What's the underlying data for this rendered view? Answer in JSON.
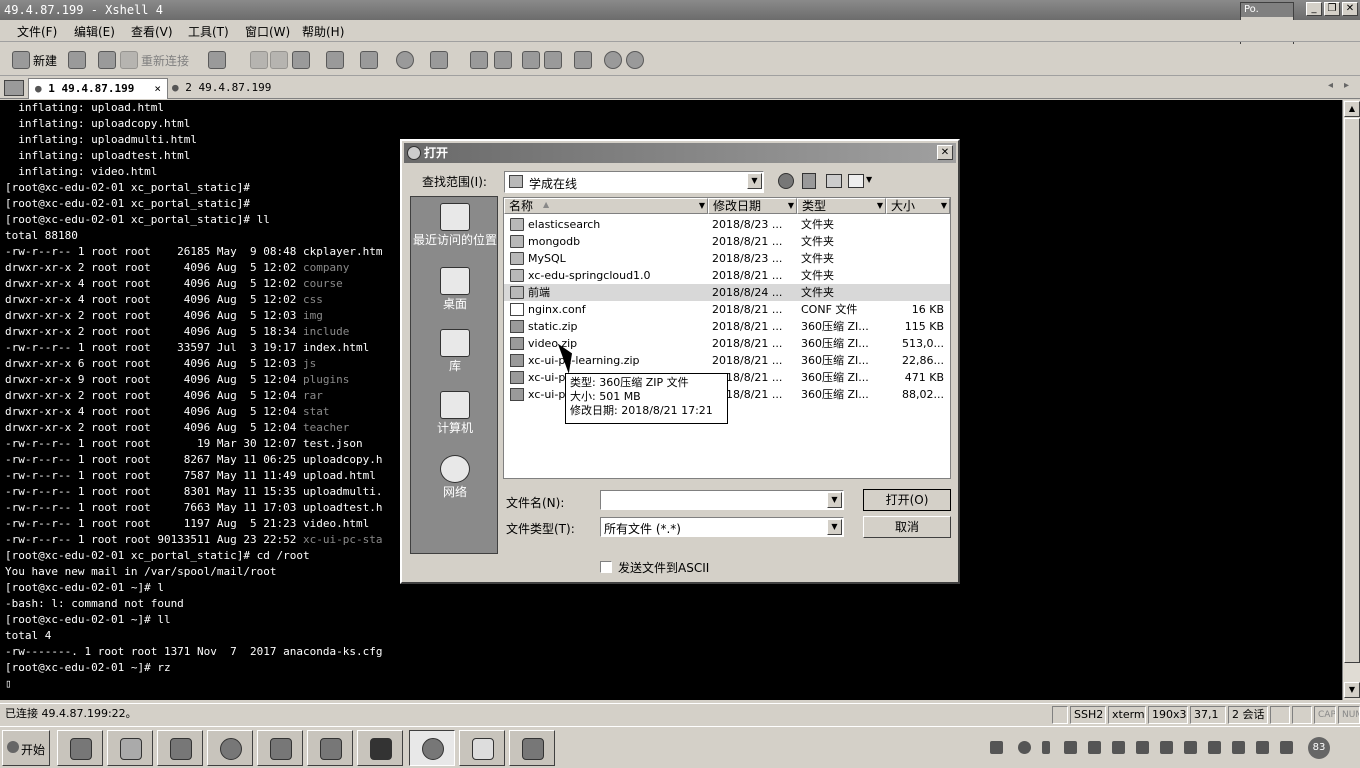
{
  "window": {
    "title": "49.4.87.199 - Xshell 4",
    "popup_title": "Po.",
    "popup_button": "开始"
  },
  "menu": [
    "文件(F)",
    "编辑(E)",
    "查看(V)",
    "工具(T)",
    "窗口(W)",
    "帮助(H)"
  ],
  "toolbar": {
    "new_label": "新建",
    "reconnect_label": "重新连接"
  },
  "tabs": [
    {
      "label": "1 49.4.87.199",
      "active": true
    },
    {
      "label": "2 49.4.87.199",
      "active": false
    }
  ],
  "terminal": {
    "lines": [
      "  inflating: upload.html",
      "  inflating: uploadcopy.html",
      "  inflating: uploadmulti.html",
      "  inflating: uploadtest.html",
      "  inflating: video.html",
      "[root@xc-edu-02-01 xc_portal_static]#",
      "[root@xc-edu-02-01 xc_portal_static]#",
      "[root@xc-edu-02-01 xc_portal_static]# ll",
      "total 88180",
      "-rw-r--r-- 1 root root    26185 May  9 08:48 ckplayer.htm",
      "drwxr-xr-x 2 root root     4096 Aug  5 12:02 company",
      "drwxr-xr-x 4 root root     4096 Aug  5 12:02 course",
      "drwxr-xr-x 4 root root     4096 Aug  5 12:02 css",
      "drwxr-xr-x 2 root root     4096 Aug  5 12:03 img",
      "drwxr-xr-x 2 root root     4096 Aug  5 18:34 include",
      "-rw-r--r-- 1 root root    33597 Jul  3 19:17 index.html",
      "drwxr-xr-x 6 root root     4096 Aug  5 12:03 js",
      "drwxr-xr-x 9 root root     4096 Aug  5 12:04 plugins",
      "drwxr-xr-x 2 root root     4096 Aug  5 12:04 rar",
      "drwxr-xr-x 4 root root     4096 Aug  5 12:04 stat",
      "drwxr-xr-x 2 root root     4096 Aug  5 12:04 teacher",
      "-rw-r--r-- 1 root root       19 Mar 30 12:07 test.json",
      "-rw-r--r-- 1 root root     8267 May 11 06:25 uploadcopy.h",
      "-rw-r--r-- 1 root root     7587 May 11 11:49 upload.html",
      "-rw-r--r-- 1 root root     8301 May 11 15:35 uploadmulti.",
      "-rw-r--r-- 1 root root     7663 May 11 17:03 uploadtest.h",
      "-rw-r--r-- 1 root root     1197 Aug  5 21:23 video.html",
      "-rw-r--r-- 1 root root 90133511 Aug 23 22:52 xc-ui-pc-sta",
      "[root@xc-edu-02-01 xc_portal_static]# cd /root",
      "You have new mail in /var/spool/mail/root",
      "[root@xc-edu-02-01 ~]# l",
      "-bash: l: command not found",
      "[root@xc-edu-02-01 ~]# ll",
      "total 4",
      "-rw-------. 1 root root 1371 Nov  7  2017 anaconda-ks.cfg",
      "[root@xc-edu-02-01 ~]# rz",
      "▯"
    ],
    "dim_lines": [
      10,
      11,
      12,
      13,
      14,
      16,
      17,
      18,
      19,
      20,
      27
    ]
  },
  "dialog": {
    "title": "打开",
    "lookin_label": "查找范围(I):",
    "lookin_value": "学成在线",
    "columns": [
      "名称",
      "修改日期",
      "类型",
      "大小"
    ],
    "files": [
      {
        "name": "elasticsearch",
        "date": "2018/8/23 ...",
        "type": "文件夹",
        "size": "",
        "kind": "folder"
      },
      {
        "name": "mongodb",
        "date": "2018/8/21 ...",
        "type": "文件夹",
        "size": "",
        "kind": "folder"
      },
      {
        "name": "MySQL",
        "date": "2018/8/23 ...",
        "type": "文件夹",
        "size": "",
        "kind": "folder"
      },
      {
        "name": "xc-edu-springcloud1.0",
        "date": "2018/8/21 ...",
        "type": "文件夹",
        "size": "",
        "kind": "folder"
      },
      {
        "name": "前端",
        "date": "2018/8/24 ...",
        "type": "文件夹",
        "size": "",
        "kind": "folder"
      },
      {
        "name": "nginx.conf",
        "date": "2018/8/21 ...",
        "type": "CONF 文件",
        "size": "16 KB",
        "kind": "file"
      },
      {
        "name": "static.zip",
        "date": "2018/8/21 ...",
        "type": "360压缩 ZI...",
        "size": "115 KB",
        "kind": "zip"
      },
      {
        "name": "video.zip",
        "date": "2018/8/21 ...",
        "type": "360压缩 ZI...",
        "size": "513,0...",
        "kind": "zip"
      },
      {
        "name": "xc-ui-pc-learning.zip",
        "date": "2018/8/21 ...",
        "type": "360压缩 ZI...",
        "size": "22,86...",
        "kind": "zip"
      },
      {
        "name": "xc-ui-pc-...",
        "date": "2018/8/21 ...",
        "type": "360压缩 ZI...",
        "size": "471 KB",
        "kind": "zip"
      },
      {
        "name": "xc-ui-pc-...",
        "date": "2018/8/21 ...",
        "type": "360压缩 ZI...",
        "size": "88,02...",
        "kind": "zip"
      }
    ],
    "selected_index": 4,
    "places": [
      "最近访问的位置",
      "桌面",
      "库",
      "计算机",
      "网络"
    ],
    "tooltip": {
      "type": "类型: 360压缩 ZIP 文件",
      "size": "大小: 501 MB",
      "modified": "修改日期: 2018/8/21 17:21"
    },
    "filename_label": "文件名(N):",
    "filename_value": "",
    "filetype_label": "文件类型(T):",
    "filetype_value": "所有文件 (*.*)",
    "open_button": "打开(O)",
    "cancel_button": "取消",
    "ascii_checkbox": "发送文件到ASCII"
  },
  "status": {
    "connection": "已连接 49.4.87.199:22。",
    "protocol": "SSH2",
    "term": "xterm",
    "size": "190x37",
    "cursor": "37,1",
    "sessions": "2 会话",
    "caps": "CAP",
    "num": "NUM"
  },
  "taskbar": {
    "start_label": "开始",
    "clock": "83"
  }
}
